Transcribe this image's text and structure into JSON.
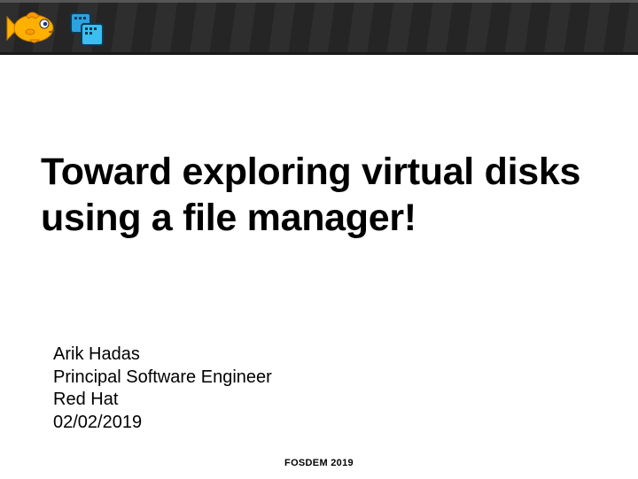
{
  "title": "Toward exploring virtual disks using a file manager!",
  "author": {
    "name": "Arik Hadas",
    "role": "Principal Software Engineer",
    "company": "Red Hat",
    "date": "02/02/2019"
  },
  "footer": "FOSDEM 2019",
  "logos": {
    "fish": "fish-logo",
    "mu": "mu-logo"
  }
}
